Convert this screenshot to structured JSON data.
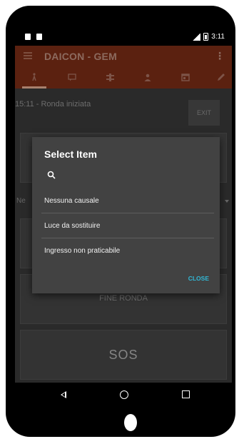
{
  "statusbar": {
    "time": "3:11",
    "icons": [
      "sim-card-icon",
      "sd-card-icon",
      "signal-icon",
      "battery-icon"
    ]
  },
  "appbar": {
    "title": "DAICON - GEM",
    "menu_icon": "hamburger-icon",
    "overflow_icon": "overflow-menu-icon"
  },
  "tabs": [
    {
      "icon": "person-walk-icon",
      "active": true
    },
    {
      "icon": "chat-icon",
      "active": false
    },
    {
      "icon": "tools-icon",
      "active": false
    },
    {
      "icon": "person-icon",
      "active": false
    },
    {
      "icon": "calendar-icon",
      "active": false
    },
    {
      "icon": "edit-icon",
      "active": false
    }
  ],
  "main": {
    "round_status": "15:11 - Ronda iniziata",
    "exit_label": "EXIT",
    "select_value": "Ne",
    "fine_ronda_label": "FINE RONDA",
    "sos_label": "SOS"
  },
  "dialog": {
    "title": "Select Item",
    "search_icon": "search-icon",
    "items": [
      {
        "label": "Nessuna causale"
      },
      {
        "label": "Luce da sostituire"
      },
      {
        "label": "Ingresso non praticabile"
      }
    ],
    "close_label": "CLOSE"
  },
  "colors": {
    "appbar_dimmed": "#5b2110",
    "dialog_bg": "#424242",
    "accent": "#31b8d6"
  }
}
